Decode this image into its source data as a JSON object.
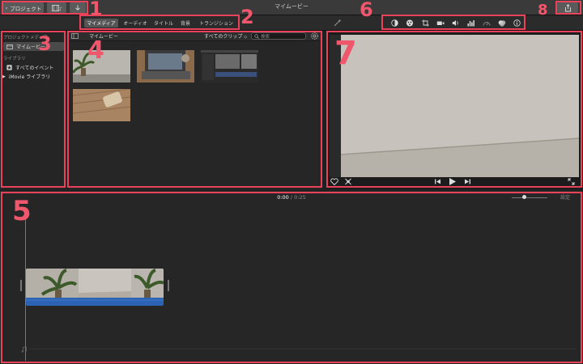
{
  "window": {
    "title": "マイムービー"
  },
  "toolbar": {
    "back_label": "プロジェクト",
    "import_icon": "download-icon",
    "share_icon": "share-icon"
  },
  "tabs": [
    {
      "label": "マイメディア",
      "active": true
    },
    {
      "label": "オーディオ"
    },
    {
      "label": "タイトル"
    },
    {
      "label": "背景"
    },
    {
      "label": "トランジション"
    }
  ],
  "adjust_tools": [
    "color-balance-icon",
    "color-correction-icon",
    "crop-icon",
    "stabilization-icon",
    "volume-icon",
    "noise-reduction-icon",
    "speed-icon",
    "filter-icon",
    "info-icon"
  ],
  "sidebar": {
    "project_section": "プロジェクトメディア",
    "project_item": "マイムービー",
    "library_section": "ライブラリ",
    "library_items": [
      "すべてのイベント",
      "iMovie ライブラリ"
    ]
  },
  "browser": {
    "header_title": "マイムービー",
    "filter_label": "すべてのクリップ",
    "search_placeholder": "検索"
  },
  "timeline": {
    "current_time": "0:00",
    "separator": "/",
    "total_time": "0:25",
    "settings_label": "設定"
  },
  "annotations": [
    "1",
    "2",
    "3",
    "4",
    "5",
    "6",
    "7",
    "8"
  ],
  "colors": {
    "annotation": "#e8435a",
    "audio_bar": "#2b63b5"
  }
}
